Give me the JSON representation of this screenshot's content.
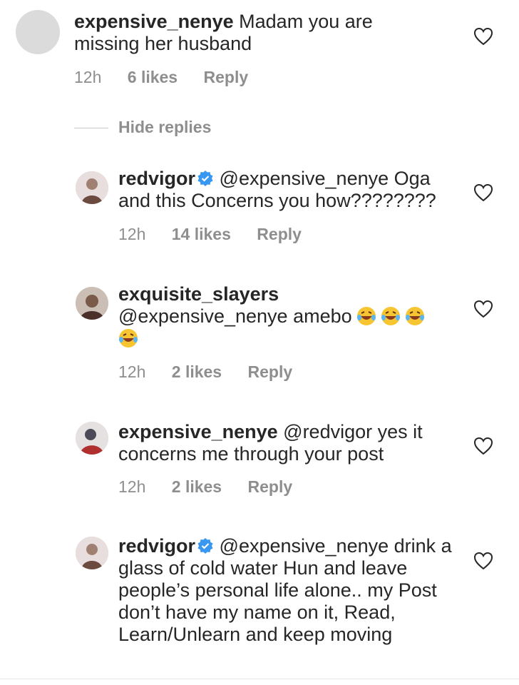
{
  "comments": [
    {
      "username": "expensive_nenye",
      "text": "Madam you are missing her husband",
      "time": "12h",
      "likes": "6 likes",
      "reply": "Reply"
    }
  ],
  "hide_replies": "Hide replies",
  "replies": [
    {
      "username": "redvigor",
      "verified": true,
      "text": "@expensive_nenye Oga and this Concerns you how????????",
      "time": "12h",
      "likes": "14 likes",
      "reply": "Reply"
    },
    {
      "username": "exquisite_slayers",
      "verified": false,
      "text": "@expensive_nenye amebo",
      "emoji": "😂😂😂😂",
      "time": "12h",
      "likes": "2 likes",
      "reply": "Reply"
    },
    {
      "username": "expensive_nenye",
      "verified": false,
      "text": "@redvigor yes it concerns me through your post",
      "time": "12h",
      "likes": "2 likes",
      "reply": "Reply"
    },
    {
      "username": "redvigor",
      "verified": true,
      "text": "@expensive_nenye drink a glass of cold water Hun and leave people’s personal life alone.. my Post don’t have my name on it, Read, Learn/Unlearn and keep moving"
    }
  ],
  "colors": {
    "verified": "#3897f0",
    "meta": "#8e8e8e",
    "text": "#262626",
    "emoji": "#f7c531"
  }
}
